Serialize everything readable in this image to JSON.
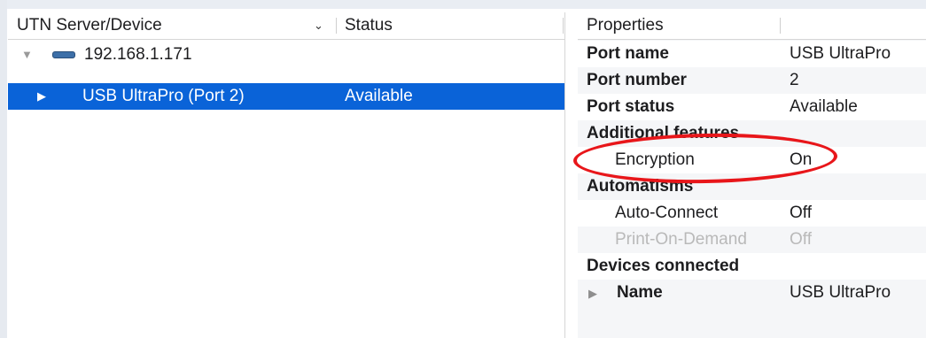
{
  "left": {
    "columns": {
      "device": "UTN Server/Device",
      "status": "Status"
    },
    "rows": [
      {
        "label": "192.168.1.171",
        "status": ""
      },
      {
        "label": "USB UltraPro (Port 2)",
        "status": "Available"
      }
    ]
  },
  "right": {
    "header": "Properties",
    "rows": [
      {
        "key": "Port name",
        "value": "USB UltraPro"
      },
      {
        "key": "Port number",
        "value": "2"
      },
      {
        "key": "Port status",
        "value": "Available"
      },
      {
        "key": "Additional features",
        "value": ""
      },
      {
        "key": "Encryption",
        "value": "On"
      },
      {
        "key": "Automatisms",
        "value": ""
      },
      {
        "key": "Auto-Connect",
        "value": "Off"
      },
      {
        "key": "Print-On-Demand",
        "value": "Off"
      },
      {
        "key": "Devices connected",
        "value": ""
      },
      {
        "key": "Name",
        "value": "USB UltraPro"
      }
    ]
  },
  "annotation": {
    "color": "#e8161a"
  },
  "colors": {
    "selection": "#0a63d8"
  }
}
